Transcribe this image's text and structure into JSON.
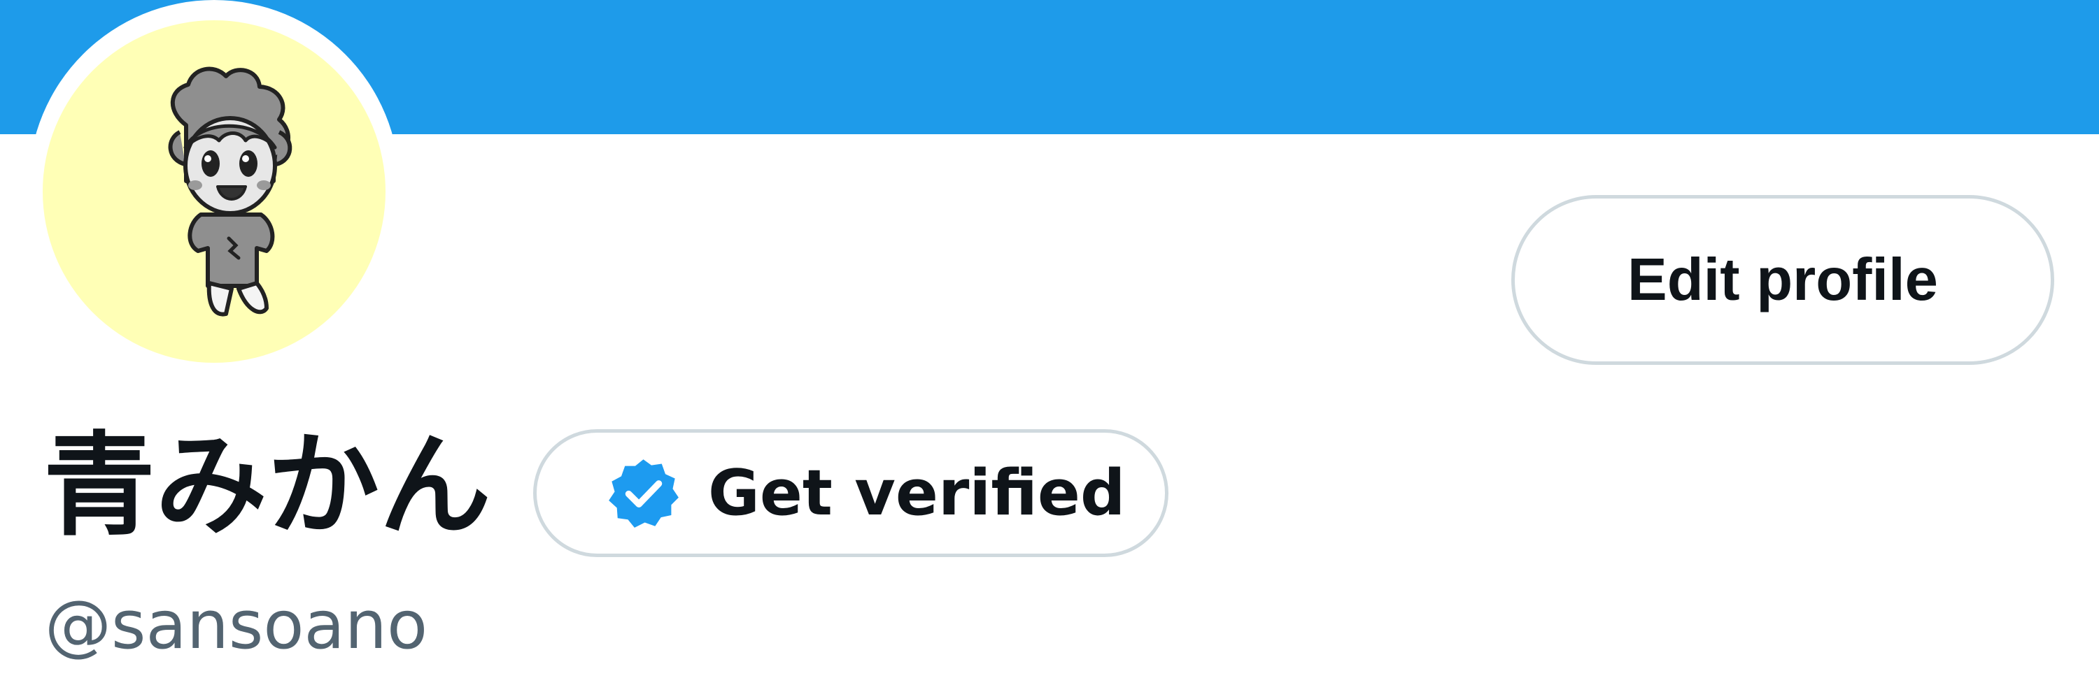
{
  "colors": {
    "banner": "#1e9bea",
    "avatar_background": "#ffffb6",
    "button_border": "#cfd9de",
    "primary_text": "#0f1419",
    "secondary_text": "#536471",
    "verified_badge": "#1d9bf0"
  },
  "profile": {
    "display_name": "青みかん",
    "handle": "@sansoano",
    "avatar_icon": "cartoon-character-avatar"
  },
  "actions": {
    "edit_profile_label": "Edit profile",
    "get_verified_label": "Get verified",
    "get_verified_icon": "verified-badge-icon"
  }
}
